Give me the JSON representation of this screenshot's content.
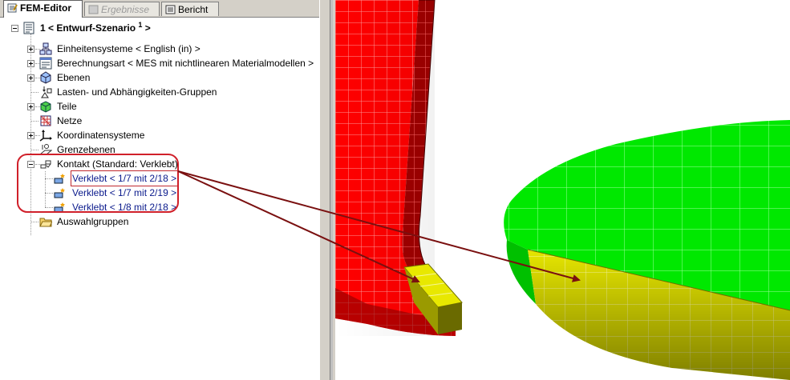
{
  "tabs": [
    {
      "label": "FEM-Editor",
      "icon": "fem-editor-icon",
      "state": "active"
    },
    {
      "label": "Ergebnisse",
      "icon": "results-icon",
      "state": "disabled"
    },
    {
      "label": "Bericht",
      "icon": "report-icon",
      "state": "normal"
    }
  ],
  "tree": {
    "root": {
      "label": "1 < Entwurf-Szenario",
      "superscript": "1",
      "suffix": " >"
    },
    "items": [
      {
        "label": "Einheitensysteme < English (in) >",
        "icon": "unit-systems-icon"
      },
      {
        "label": "Berechnungsart < MES mit nichtlinearen Materialmodellen >",
        "icon": "analysis-type-icon"
      },
      {
        "label": "Ebenen",
        "icon": "layers-icon"
      },
      {
        "label": "Lasten- und Abhängigkeiten-Gruppen",
        "icon": "loads-icon"
      },
      {
        "label": "Teile",
        "icon": "parts-icon"
      },
      {
        "label": "Netze",
        "icon": "mesh-icon"
      },
      {
        "label": "Koordinatensysteme",
        "icon": "coordinate-systems-icon"
      },
      {
        "label": "Grenzebenen",
        "icon": "boundary-planes-icon"
      },
      {
        "label": "Kontakt (Standard: Verklebt)",
        "icon": "contact-icon"
      },
      {
        "label": "Auswahlgruppen",
        "icon": "folder-icon"
      }
    ],
    "contacts": [
      {
        "label": "Verklebt < 1/7 mit 2/18 >"
      },
      {
        "label": "Verklebt < 1/7 mit 2/19 >"
      },
      {
        "label": "Verklebt < 1/8 mit 2/18 >"
      }
    ]
  },
  "colors": {
    "part_red": "#ff0000",
    "part_green": "#00ee00",
    "contact_yellow": "#e8e800",
    "highlight": "#d0202a",
    "arrow": "#7a1010"
  }
}
